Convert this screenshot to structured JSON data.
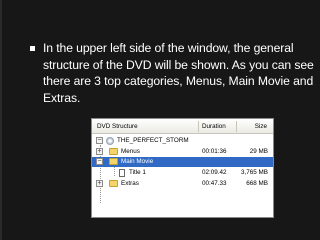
{
  "slide": {
    "bullet_text": "In the upper left side of the window, the general structure of the DVD will be shown. As you can see there are 3 top categories, Menus, Main Movie and Extras."
  },
  "tree": {
    "columns": {
      "name": "DVD Structure",
      "duration": "Duration",
      "size": "Size"
    },
    "root": "THE_PERFECT_STORM",
    "rows": [
      {
        "label": "Menus",
        "duration": "00:01:36",
        "size": "29 MB",
        "expander": "+",
        "selected": false
      },
      {
        "label": "Main Movie",
        "duration": "",
        "size": "",
        "expander": "−",
        "selected": true
      },
      {
        "label": "Title 1",
        "duration": "02:09.42",
        "size": "3,765 MB",
        "expander": "",
        "selected": false
      },
      {
        "label": "Extras",
        "duration": "00:47.33",
        "size": "668 MB",
        "expander": "+",
        "selected": false
      }
    ]
  },
  "colors": {
    "selection": "#316ac5",
    "background": "#171717",
    "text": "#ffffff"
  }
}
